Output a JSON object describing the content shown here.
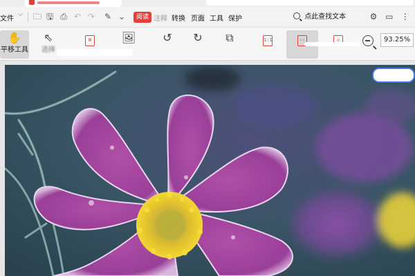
{
  "menubar": {
    "file_label": "文件",
    "badge": "阅读",
    "items": [
      "转换",
      "页面",
      "工具",
      "保护"
    ],
    "blurred_item": "注释",
    "search_label": "点此查找文本"
  },
  "ribbon": {
    "hand_tool_label": "平移工具",
    "select_tool_label": "选择",
    "zoom_value": "93.25%",
    "single_page_icon_text": "1:1"
  },
  "icons": {
    "colors": {
      "accent_red": "#e0413b",
      "selection_blue": "#3d7be0"
    }
  }
}
